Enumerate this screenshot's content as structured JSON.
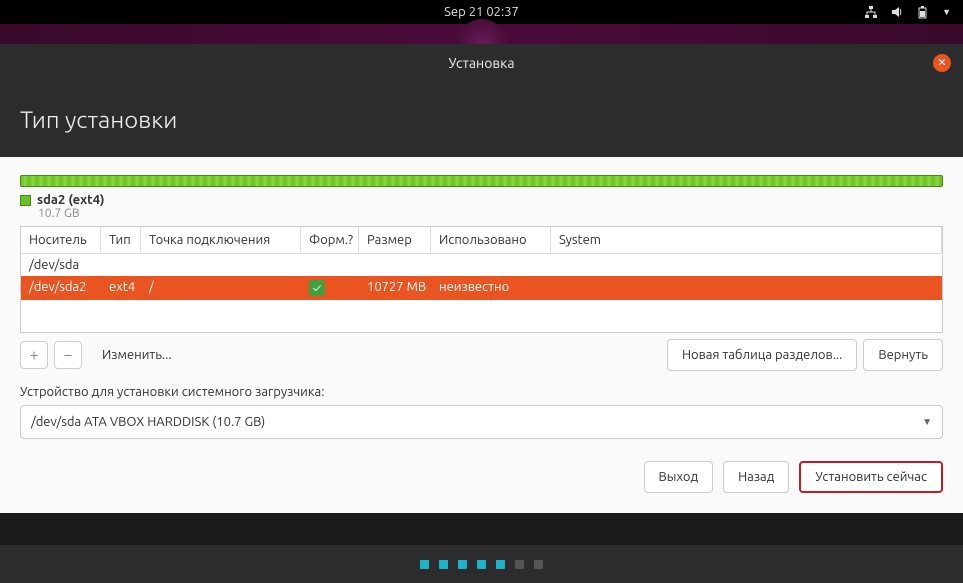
{
  "topbar": {
    "datetime": "Sep 21  02:37"
  },
  "window": {
    "title": "Установка",
    "heading": "Тип установки"
  },
  "partition": {
    "name": "sda2 (ext4)",
    "size": "10.7 GB"
  },
  "table": {
    "headers": {
      "device": "Носитель",
      "type": "Тип",
      "mount": "Точка подключения",
      "format": "Форм.?",
      "size": "Размер",
      "used": "Использовано",
      "system": "System"
    },
    "rows": [
      {
        "device": "/dev/sda",
        "type": "",
        "mount": "",
        "format": "",
        "size": "",
        "used": "",
        "system": "",
        "selected": false
      },
      {
        "device": "/dev/sda2",
        "type": "ext4",
        "mount": "/",
        "format": "check",
        "size": "10727 MB",
        "used": "неизвестно",
        "system": "",
        "selected": true
      }
    ]
  },
  "toolbelt": {
    "edit": "Изменить...",
    "new_table": "Новая таблица разделов...",
    "revert": "Вернуть"
  },
  "bootloader": {
    "label": "Устройство для установки системного загрузчика:",
    "value": "/dev/sda   ATA VBOX HARDDISK (10.7 GB)"
  },
  "footer": {
    "quit": "Выход",
    "back": "Назад",
    "install": "Установить сейчас"
  },
  "progress": {
    "total": 7,
    "active": 4
  }
}
